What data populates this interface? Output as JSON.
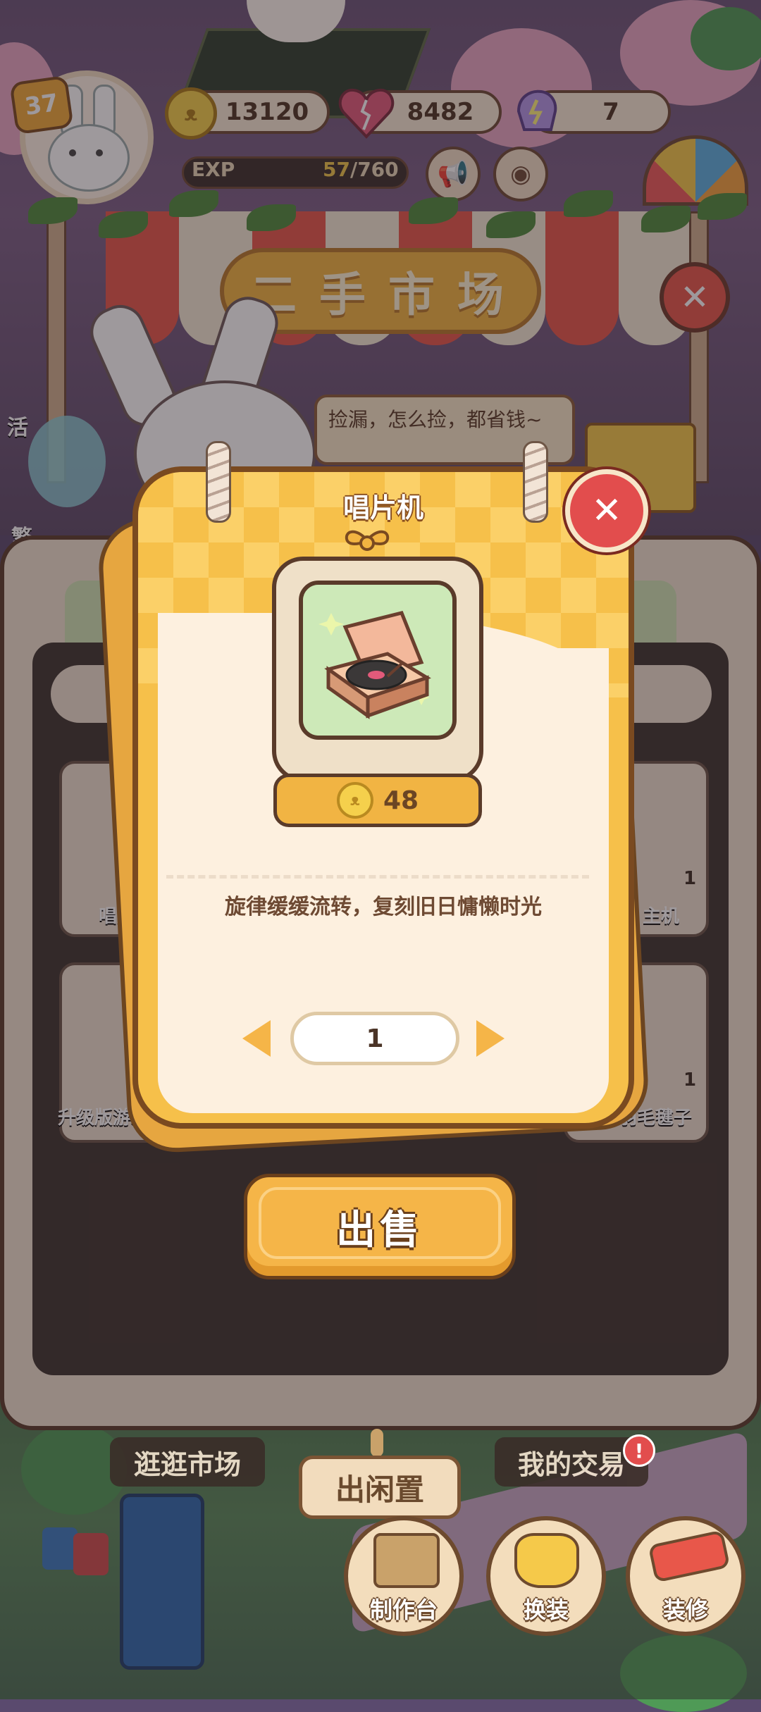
{
  "hud": {
    "level": "37",
    "coins": "13120",
    "hearts": "8482",
    "energy": "7",
    "exp_label": "EXP",
    "exp_current": "57",
    "exp_max": "/760"
  },
  "market": {
    "sign_chars": [
      "二",
      "手",
      "市",
      "场"
    ],
    "speech": "捡漏，怎么捡，都省钱~"
  },
  "side_labels": {
    "left_top": "活",
    "left_bottom": "繁"
  },
  "background_slots": [
    {
      "label": "唱片",
      "count": ""
    },
    {
      "label": "主机",
      "count": "1"
    },
    {
      "label": "升级版游戏主",
      "count": ""
    },
    {
      "label": "绿色羽毛毽子",
      "count": "1"
    }
  ],
  "modal": {
    "title": "唱片机",
    "price": "48",
    "description": "旋律缓缓流转，复刻旧日慵懒时光",
    "quantity": "1",
    "sell_label": "出售"
  },
  "bottom_nav": {
    "browse_label": "逛逛市场",
    "idle_label": "出闲置",
    "trades_label": "我的交易",
    "trades_badge": "!",
    "workbench_label": "制作台",
    "dressup_label": "换装",
    "decorate_label": "装修"
  },
  "colors": {
    "accent_orange": "#f5b548",
    "close_red": "#e24d4d",
    "dark_outline": "#5a3b2a",
    "cream": "#fdf0df"
  }
}
